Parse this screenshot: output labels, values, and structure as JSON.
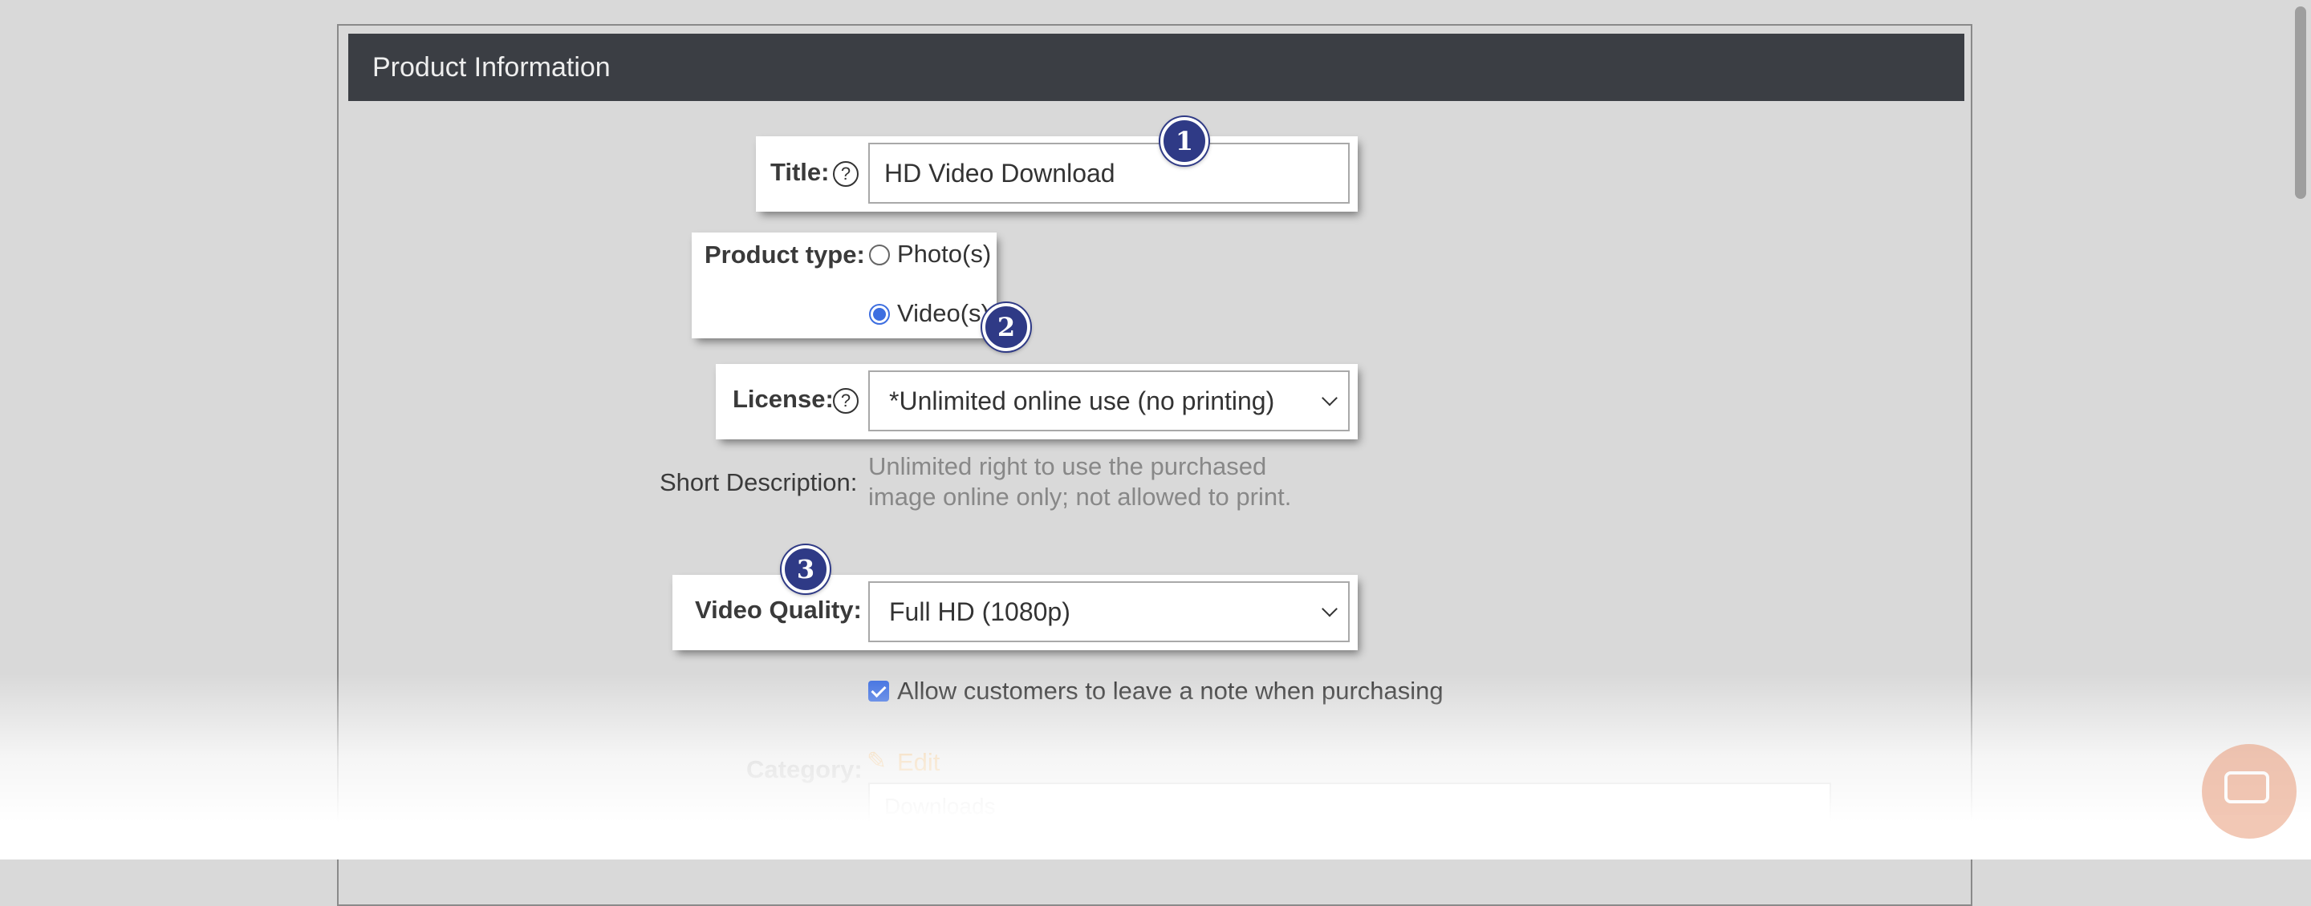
{
  "panel": {
    "title": "Product Information"
  },
  "title_field": {
    "label": "Title:",
    "value": "HD Video Download",
    "help": "?"
  },
  "product_type": {
    "label": "Product type:",
    "options": [
      {
        "label": "Photo(s)",
        "checked": false
      },
      {
        "label": "Video(s)",
        "checked": true
      }
    ]
  },
  "license": {
    "label": "License:",
    "help": "?",
    "selected": "*Unlimited online use (no printing)"
  },
  "short_description": {
    "label": "Short Description:",
    "line1": "Unlimited right to use the purchased",
    "line2": "image online only; not allowed to print."
  },
  "video_quality": {
    "label": "Video Quality:",
    "selected": "Full HD (1080p)"
  },
  "allow_note": {
    "label": "Allow customers to leave a note when purchasing",
    "checked": true
  },
  "category": {
    "label": "Category:",
    "edit_label": "Edit",
    "selected": "Downloads"
  },
  "badges": [
    "1",
    "2",
    "3"
  ],
  "colors": {
    "header": "#3b3e44",
    "accent": "#3d6ee0",
    "badge": "#2f3a86",
    "edit": "#e0a04a"
  },
  "icons": [
    "help-icon",
    "chevron-down-icon",
    "pencil-icon",
    "chat-icon"
  ]
}
